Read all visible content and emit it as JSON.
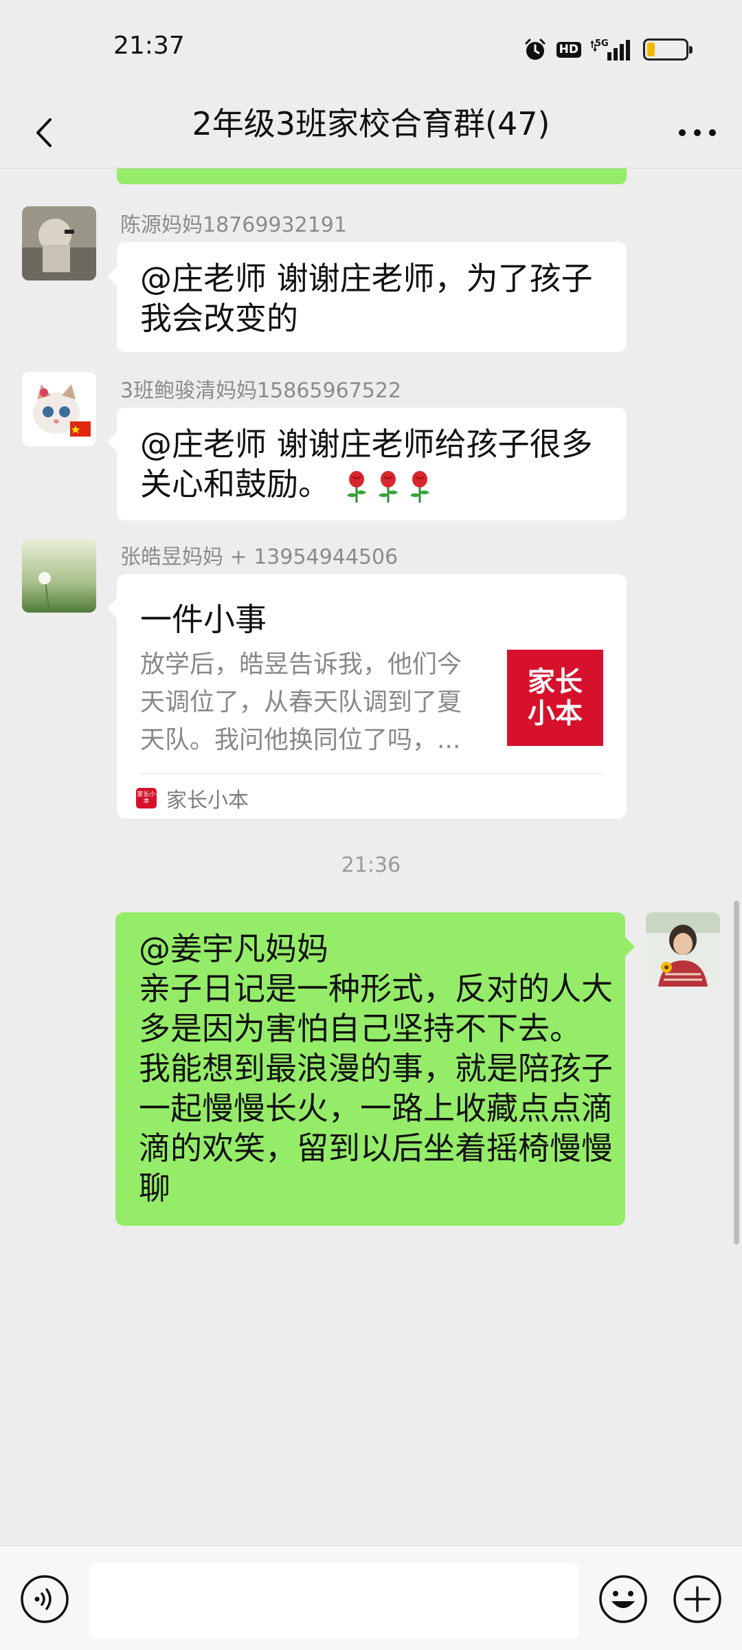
{
  "status_bar": {
    "time": "21:37",
    "hd_label": "HD",
    "network_label": "5G",
    "battery_level": 0.2
  },
  "header": {
    "title": "2年级3班家校合育群(47)",
    "back_icon": "chevron-left-icon",
    "more_icon": "more-dots-icon"
  },
  "messages": [
    {
      "sender": "陈源妈妈18769932191",
      "lines": [
        "@庄老师  谢谢庄老师，为了孩子",
        "我会改变的"
      ]
    },
    {
      "sender": "3班鲍骏清妈妈15865967522",
      "lines": [
        "@庄老师  谢谢庄老师给孩子很多",
        "关心和鼓励。"
      ],
      "emoji": [
        "🌹",
        "🌹",
        "🌹"
      ]
    },
    {
      "sender": "张皓昱妈妈 + 13954944506",
      "card": {
        "title": "一件小事",
        "desc_lines": [
          "放学后，皓昱告诉我，他们今",
          "天调位了，从春天队调到了夏",
          "天队。我问他换同位了吗，..."
        ],
        "thumb_lines": [
          "家长",
          "小本"
        ],
        "source": "家长小本",
        "source_icon_text": "家长小本"
      }
    }
  ],
  "timestamp": "21:36",
  "my_message": {
    "lines": [
      "@姜宇凡妈妈",
      "亲子日记是一种形式，反对的人大",
      "多是因为害怕自己坚持不下去。",
      "我能想到最浪漫的事，就是陪孩子",
      "一起慢慢长火，一路上收藏点点滴",
      "滴的欢笑，留到以后坐着摇椅慢慢",
      "聊"
    ]
  },
  "input_bar": {
    "placeholder": "",
    "voice_icon": "voice-icon",
    "emoji_icon": "emoji-icon",
    "plus_icon": "plus-icon"
  },
  "colors": {
    "background": "#ededed",
    "my_bubble": "#95ec69",
    "other_bubble": "#ffffff",
    "brand_red": "#d7102c"
  }
}
